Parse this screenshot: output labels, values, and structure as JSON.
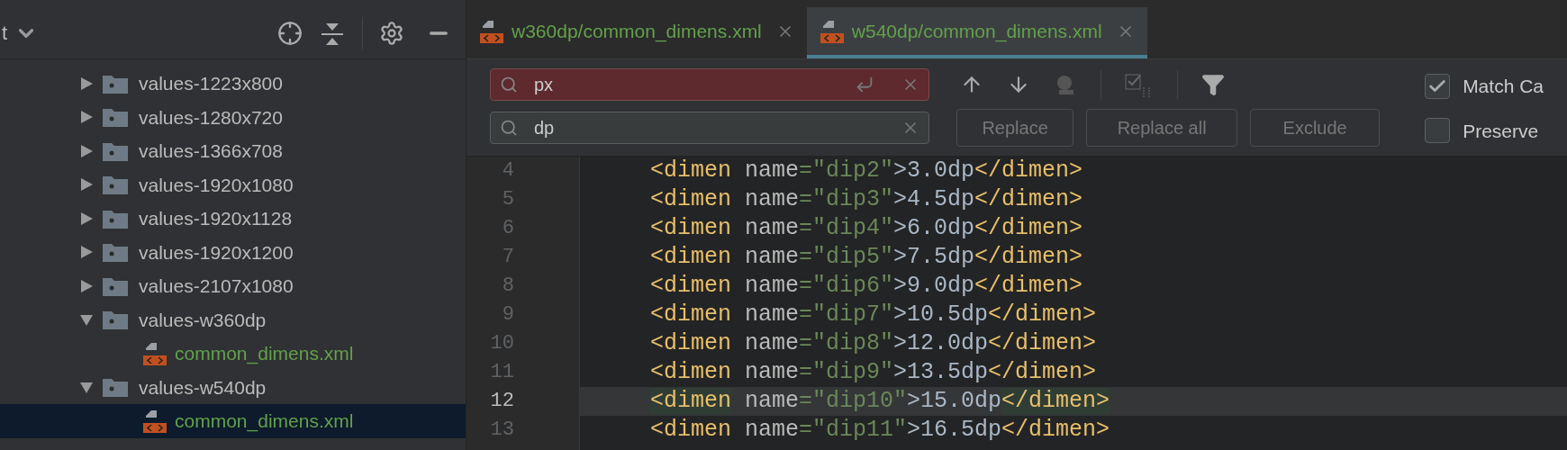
{
  "project_panel": {
    "view_label": "t",
    "tree": [
      {
        "label": "values-1223x800",
        "expanded": false
      },
      {
        "label": "values-1280x720",
        "expanded": false
      },
      {
        "label": "values-1366x708",
        "expanded": false
      },
      {
        "label": "values-1920x1080",
        "expanded": false
      },
      {
        "label": "values-1920x1128",
        "expanded": false
      },
      {
        "label": "values-1920x1200",
        "expanded": false
      },
      {
        "label": "values-2107x1080",
        "expanded": false
      },
      {
        "label": "values-w360dp",
        "expanded": true,
        "children": [
          {
            "label": "common_dimens.xml",
            "selected": false
          }
        ]
      },
      {
        "label": "values-w540dp",
        "expanded": true,
        "children": [
          {
            "label": "common_dimens.xml",
            "selected": true
          }
        ]
      }
    ]
  },
  "tabs": [
    {
      "label": "w360dp/common_dimens.xml",
      "selected": false
    },
    {
      "label": "w540dp/common_dimens.xml",
      "selected": true
    }
  ],
  "find": {
    "search_value": "px",
    "no_match": true,
    "replace_value": "dp",
    "buttons": [
      {
        "label": "Replace",
        "disabled": true
      },
      {
        "label": "Replace all",
        "disabled": true
      },
      {
        "label": "Exclude",
        "disabled": true
      }
    ],
    "options": [
      {
        "label": "Match Ca",
        "checked": true
      },
      {
        "label": "Preserve",
        "checked": false
      }
    ]
  },
  "editor": {
    "lines": [
      {
        "number": "4",
        "current": false,
        "tokens": [
          {
            "kind": "tag",
            "text": "<dimen"
          },
          {
            "kind": "attr",
            "text": " name"
          },
          {
            "kind": "value",
            "text": "=\"dip2\""
          },
          {
            "kind": "text",
            "text": ">3.0dp"
          },
          {
            "kind": "tag",
            "text": "</dimen>"
          }
        ]
      },
      {
        "number": "5",
        "current": false,
        "tokens": [
          {
            "kind": "tag",
            "text": "<dimen"
          },
          {
            "kind": "attr",
            "text": " name"
          },
          {
            "kind": "value",
            "text": "=\"dip3\""
          },
          {
            "kind": "text",
            "text": ">4.5dp"
          },
          {
            "kind": "tag",
            "text": "</dimen>"
          }
        ]
      },
      {
        "number": "6",
        "current": false,
        "tokens": [
          {
            "kind": "tag",
            "text": "<dimen"
          },
          {
            "kind": "attr",
            "text": " name"
          },
          {
            "kind": "value",
            "text": "=\"dip4\""
          },
          {
            "kind": "text",
            "text": ">6.0dp"
          },
          {
            "kind": "tag",
            "text": "</dimen>"
          }
        ]
      },
      {
        "number": "7",
        "current": false,
        "tokens": [
          {
            "kind": "tag",
            "text": "<dimen"
          },
          {
            "kind": "attr",
            "text": " name"
          },
          {
            "kind": "value",
            "text": "=\"dip5\""
          },
          {
            "kind": "text",
            "text": ">7.5dp"
          },
          {
            "kind": "tag",
            "text": "</dimen>"
          }
        ]
      },
      {
        "number": "8",
        "current": false,
        "tokens": [
          {
            "kind": "tag",
            "text": "<dimen"
          },
          {
            "kind": "attr",
            "text": " name"
          },
          {
            "kind": "value",
            "text": "=\"dip6\""
          },
          {
            "kind": "text",
            "text": ">9.0dp"
          },
          {
            "kind": "tag",
            "text": "</dimen>"
          }
        ]
      },
      {
        "number": "9",
        "current": false,
        "tokens": [
          {
            "kind": "tag",
            "text": "<dimen"
          },
          {
            "kind": "attr",
            "text": " name"
          },
          {
            "kind": "value",
            "text": "=\"dip7\""
          },
          {
            "kind": "text",
            "text": ">10.5dp"
          },
          {
            "kind": "tag",
            "text": "</dimen>"
          }
        ]
      },
      {
        "number": "10",
        "current": false,
        "tokens": [
          {
            "kind": "tag",
            "text": "<dimen"
          },
          {
            "kind": "attr",
            "text": " name"
          },
          {
            "kind": "value",
            "text": "=\"dip8\""
          },
          {
            "kind": "text",
            "text": ">12.0dp"
          },
          {
            "kind": "tag",
            "text": "</dimen>"
          }
        ]
      },
      {
        "number": "11",
        "current": false,
        "tokens": [
          {
            "kind": "tag",
            "text": "<dimen"
          },
          {
            "kind": "attr",
            "text": " name"
          },
          {
            "kind": "value",
            "text": "=\"dip9\""
          },
          {
            "kind": "text",
            "text": ">13.5dp"
          },
          {
            "kind": "tag",
            "text": "</dimen>"
          }
        ]
      },
      {
        "number": "12",
        "current": true,
        "tokens": [
          {
            "kind": "tag_matched",
            "text": "<dimen"
          },
          {
            "kind": "attr",
            "text": " name"
          },
          {
            "kind": "value",
            "text": "=\"dip10\""
          },
          {
            "kind": "text",
            "text": ">15.0dp"
          },
          {
            "kind": "tag_matched",
            "text": "</dimen>"
          }
        ]
      },
      {
        "number": "13",
        "current": false,
        "tokens": [
          {
            "kind": "tag",
            "text": "<dimen"
          },
          {
            "kind": "attr",
            "text": " name"
          },
          {
            "kind": "value",
            "text": "=\"dip11\""
          },
          {
            "kind": "text",
            "text": ">16.5dp"
          },
          {
            "kind": "tag",
            "text": "</dimen>"
          }
        ]
      }
    ]
  }
}
